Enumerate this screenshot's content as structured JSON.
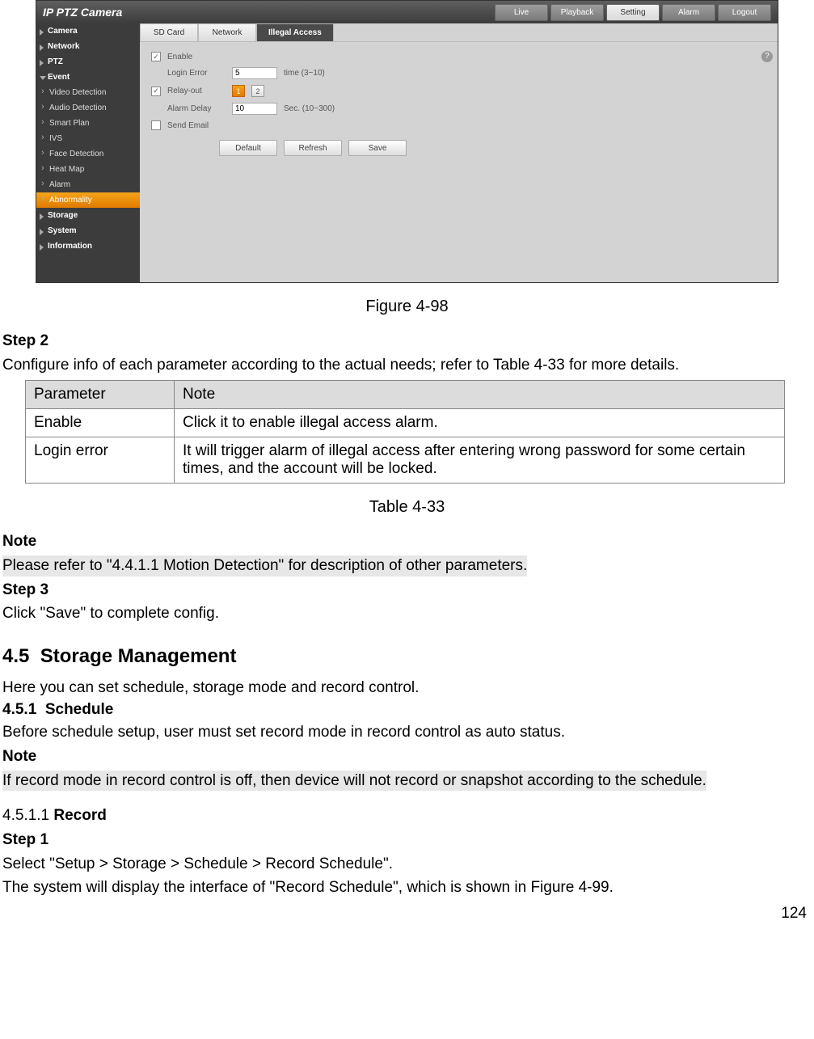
{
  "screenshot": {
    "title": "IP PTZ Camera",
    "tabs": {
      "live": "Live",
      "playback": "Playback",
      "setting": "Setting",
      "alarm": "Alarm",
      "logout": "Logout"
    },
    "help": "?",
    "sidebar": {
      "camera": "Camera",
      "network": "Network",
      "ptz": "PTZ",
      "event": "Event",
      "videoDetection": "Video Detection",
      "audioDetection": "Audio Detection",
      "smartPlan": "Smart Plan",
      "ivs": "IVS",
      "faceDetection": "Face Detection",
      "heatMap": "Heat Map",
      "alarm": "Alarm",
      "abnormality": "Abnormality",
      "storage": "Storage",
      "system": "System",
      "information": "Information"
    },
    "subtabs": {
      "sd": "SD Card",
      "network": "Network",
      "illegal": "Illegal Access"
    },
    "form": {
      "enable": "Enable",
      "loginError": "Login Error",
      "loginErrorVal": "5",
      "loginErrorHint": "time (3~10)",
      "relayOut": "Relay-out",
      "relay1": "1",
      "relay2": "2",
      "alarmDelay": "Alarm Delay",
      "alarmDelayVal": "10",
      "alarmDelayHint": "Sec. (10~300)",
      "sendEmail": "Send Email",
      "default": "Default",
      "refresh": "Refresh",
      "save": "Save",
      "check": "✓"
    }
  },
  "captions": {
    "fig": "Figure 4-98",
    "table": "Table 4-33"
  },
  "step2": {
    "title": "Step 2",
    "text": "Configure info of each parameter according to the actual needs; refer to Table 4-33 for more details."
  },
  "table": {
    "h1": "Parameter",
    "h2": "Note",
    "r1c1": "Enable",
    "r1c2": "Click it to enable illegal access alarm.",
    "r2c1": "Login error",
    "r2c2": "It will trigger alarm of illegal access after entering wrong password for some certain times, and the account will be locked."
  },
  "note1": {
    "title": "Note",
    "text": "Please refer to \"4.4.1.1 Motion Detection\" for description of other parameters."
  },
  "step3": {
    "title": "Step 3",
    "text": "Click \"Save\" to complete config."
  },
  "sec45": {
    "num": "4.5",
    "title": "Storage Management",
    "text": "Here you can set schedule, storage mode and record control."
  },
  "sec451": {
    "num": "4.5.1",
    "title": "Schedule",
    "text": "Before schedule setup, user must set record mode in record control as auto status."
  },
  "note2": {
    "title": "Note",
    "text": "If record mode in record control is off, then device will not record or snapshot according to the schedule."
  },
  "sec4511": {
    "num": "4.5.1.1",
    "title": "Record"
  },
  "step1b": {
    "title": "Step 1",
    "line1": "Select \"Setup > Storage > Schedule > Record Schedule\".",
    "line2": "The system will display the interface of \"Record Schedule\", which is shown in Figure 4-99."
  },
  "pagenum": "124"
}
